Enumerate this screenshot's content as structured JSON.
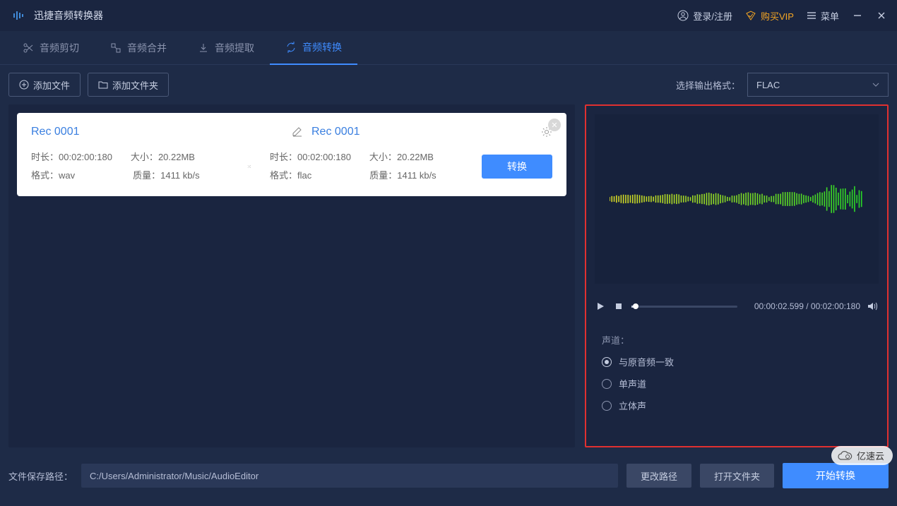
{
  "app": {
    "title": "迅捷音频转换器"
  },
  "titlebar": {
    "login": "登录/注册",
    "vip": "购买VIP",
    "menu": "菜单"
  },
  "nav": {
    "cut": "音频剪切",
    "merge": "音频合并",
    "extract": "音频提取",
    "convert": "音频转换"
  },
  "toolbar": {
    "add_file": "添加文件",
    "add_folder": "添加文件夹",
    "output_format_label": "选择输出格式：",
    "output_format_value": "FLAC"
  },
  "file": {
    "source_name": "Rec 0001",
    "target_name": "Rec 0001",
    "src": {
      "duration_label": "时长：",
      "duration": "00:02:00:180",
      "size_label": "大小：",
      "size": "20.22MB",
      "format_label": "格式：",
      "format": "wav",
      "quality_label": "质量：",
      "quality": "1411 kb/s"
    },
    "dst": {
      "duration_label": "时长：",
      "duration": "00:02:00:180",
      "size_label": "大小：",
      "size": "20.22MB",
      "format_label": "格式：",
      "format": "flac",
      "quality_label": "质量：",
      "quality": "1411 kb/s"
    },
    "convert_btn": "转换"
  },
  "player": {
    "current_time": "00:00:02.599",
    "sep": " / ",
    "total_time": "00:02:00:180"
  },
  "channels": {
    "title": "声道：",
    "same": "与原音频一致",
    "mono": "单声道",
    "stereo": "立体声"
  },
  "footer": {
    "path_label": "文件保存路径：",
    "path_value": "C:/Users/Administrator/Music/AudioEditor",
    "change": "更改路径",
    "open": "打开文件夹",
    "start": "开始转换"
  },
  "watermark": {
    "text": "亿速云"
  }
}
